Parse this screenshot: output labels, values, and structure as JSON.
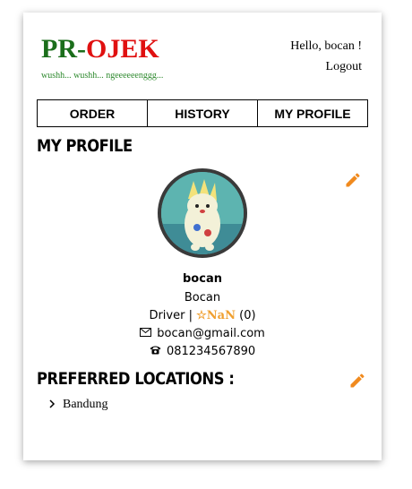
{
  "logo": {
    "pr": "PR",
    "dash": "-",
    "ojek": "OJEK"
  },
  "tagline": "wushh... wushh... ngeeeeeenggg...",
  "user": {
    "greeting": "Hello, bocan !",
    "logout": "Logout"
  },
  "nav": [
    "ORDER",
    "HISTORY",
    "MY PROFILE"
  ],
  "profile": {
    "section_title": "MY PROFILE",
    "username": "bocan",
    "name": "Bocan",
    "role": "Driver",
    "separator": "|",
    "rating": "☆NaN",
    "rating_count": "(0)",
    "email": "bocan@gmail.com",
    "phone": "081234567890"
  },
  "locations": {
    "section_title": "PREFERRED LOCATIONS :",
    "items": [
      "Bandung"
    ]
  },
  "colors": {
    "edit_icon": "#f08a1e",
    "logo_green": "#1b6e1b",
    "logo_red": "#e01010",
    "star": "#f0a030"
  },
  "icons": {
    "edit": "pencil-icon",
    "email": "envelope-icon",
    "phone": "phone-icon",
    "chevron": "chevron-right-icon"
  }
}
